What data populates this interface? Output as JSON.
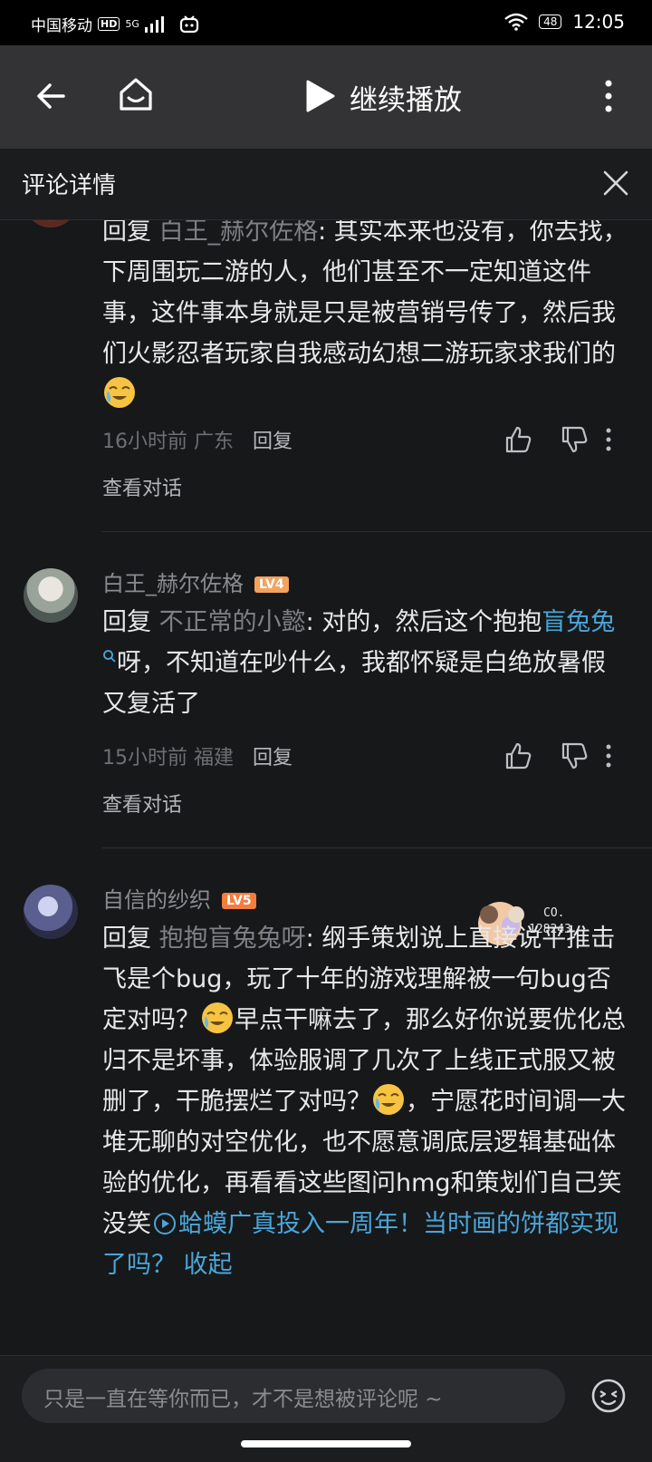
{
  "status": {
    "carrier": "中国移动",
    "hd": "HD",
    "net": "5G",
    "battery": "48",
    "time": "12:05"
  },
  "topbar": {
    "resume_label": "继续播放"
  },
  "detail": {
    "title": "评论详情"
  },
  "comments": [
    {
      "reply_prefix": "回复 ",
      "reply_to": "白王_赫尔佐格",
      "text": ": 其实本来也没有，你去找，下周围玩二游的人，他们甚至不一定知道这件事，这件事本身就是只是被营销号传了，然后我们火影忍者玩家自我感动幻想二游玩家求我们的",
      "time": "16小时前",
      "location": "广东",
      "reply_label": "回复",
      "view_conv": "查看对话"
    },
    {
      "username": "白王_赫尔佐格",
      "level": "LV4",
      "reply_prefix": "回复 ",
      "reply_to": "不正常的小懿",
      "text_a": ": 对的，然后这个抱抱",
      "link": "盲兔兔",
      "text_b": "呀，不知道在吵什么，我都怀疑是白绝放暑假又复活了",
      "time": "15小时前",
      "location": "福建",
      "reply_label": "回复",
      "view_conv": "查看对话"
    },
    {
      "username": "自信的纱织",
      "level": "LV5",
      "badge_text": "CO.",
      "badge_num": "128243",
      "reply_prefix": "回复 ",
      "reply_to": "抱抱盲兔兔呀",
      "text_a": ": 纲手策划说上直接说平推击飞是个bug，玩了十年的游戏理解被一句bug否定对吗？",
      "text_b": "早点干嘛去了，那么好你说要优化总归不是坏事，体验服调了几次了上线正式服又被删了，干脆摆烂了对吗？",
      "text_c": "，宁愿花时间调一大堆无聊的对空优化，也不愿意调底层逻辑基础体验的优化，再看看这些图问hmg和策划们自己笑没笑",
      "video_link": "蛤蟆广真投入一周年！当时画的饼都实现了吗？",
      "collapse": "收起"
    }
  ],
  "input": {
    "placeholder": "只是一直在等你而已，才不是想被评论呢 ~"
  },
  "colors": {
    "link": "#4aa6d9",
    "lv4": "#f2a35e",
    "lv5": "#f27d3e",
    "bg": "#17181a"
  }
}
